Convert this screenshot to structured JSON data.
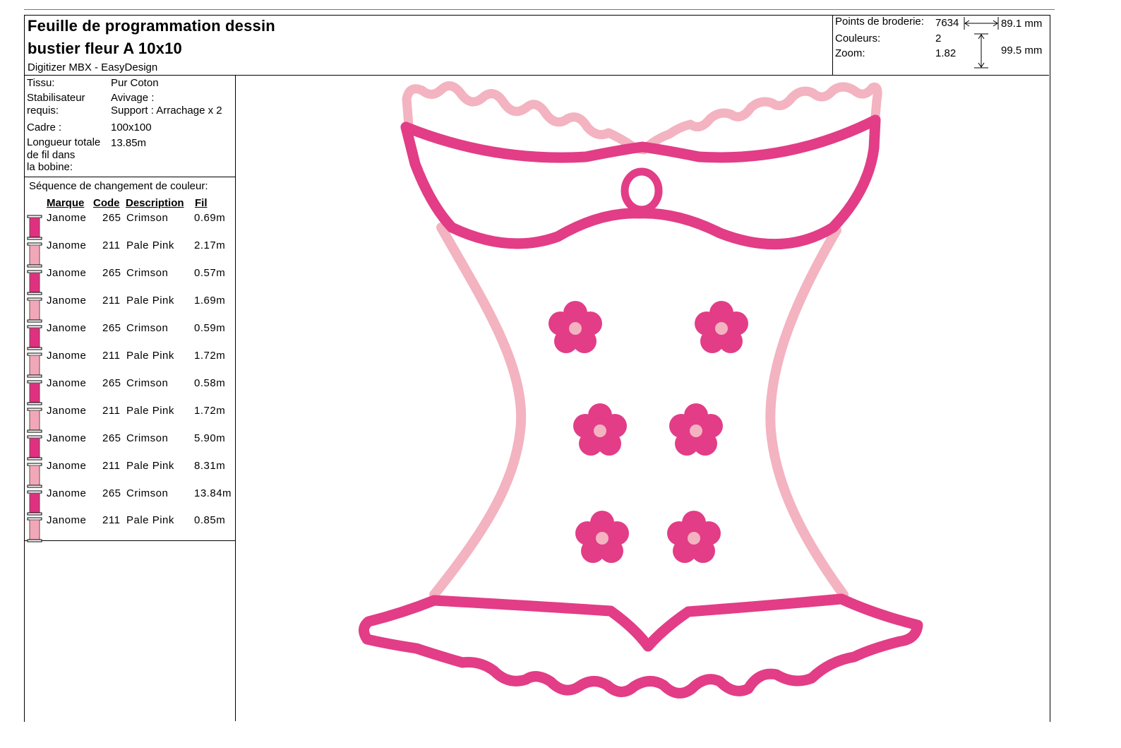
{
  "header": {
    "title_line1": "Feuille de programmation dessin",
    "title_line2": "bustier fleur A 10x10",
    "software": "Digitizer MBX - EasyDesign"
  },
  "stats": {
    "stitches_label": "Points de broderie:",
    "stitches_value": "7634",
    "colors_label": "Couleurs:",
    "colors_value": "2",
    "zoom_label": "Zoom:",
    "zoom_value": "1.82",
    "width": "89.1 mm",
    "height": "99.5 mm"
  },
  "info": {
    "fabric_label": "Tissu:",
    "fabric_value": "Pur Coton",
    "stabilizer_label_1": "Stabilisateur",
    "stabilizer_label_2": "requis:",
    "stabilizer_value_1": "Avivage :",
    "stabilizer_value_2": "Support : Arrachage x 2",
    "frame_label": "Cadre :",
    "frame_value": "100x100",
    "bobbin_label_1": "Longueur totale",
    "bobbin_label_2": "de fil dans",
    "bobbin_label_3": "la bobine:",
    "bobbin_value": "13.85m"
  },
  "sequence": {
    "title": "Séquence de changement de couleur:",
    "columns": {
      "brand": "Marque",
      "code": "Code",
      "description": "Description",
      "thread": "Fil"
    },
    "rows": [
      {
        "brand": "Janome",
        "code": "265",
        "description": "Crimson",
        "thread": "0.69m"
      },
      {
        "brand": "Janome",
        "code": "211",
        "description": "Pale Pink",
        "thread": "2.17m"
      },
      {
        "brand": "Janome",
        "code": "265",
        "description": "Crimson",
        "thread": "0.57m"
      },
      {
        "brand": "Janome",
        "code": "211",
        "description": "Pale Pink",
        "thread": "1.69m"
      },
      {
        "brand": "Janome",
        "code": "265",
        "description": "Crimson",
        "thread": "0.59m"
      },
      {
        "brand": "Janome",
        "code": "211",
        "description": "Pale Pink",
        "thread": "1.72m"
      },
      {
        "brand": "Janome",
        "code": "265",
        "description": "Crimson",
        "thread": "0.58m"
      },
      {
        "brand": "Janome",
        "code": "211",
        "description": "Pale Pink",
        "thread": "1.72m"
      },
      {
        "brand": "Janome",
        "code": "265",
        "description": "Crimson",
        "thread": "5.90m"
      },
      {
        "brand": "Janome",
        "code": "211",
        "description": "Pale Pink",
        "thread": "8.31m"
      },
      {
        "brand": "Janome",
        "code": "265",
        "description": "Crimson",
        "thread": "13.84m"
      },
      {
        "brand": "Janome",
        "code": "211",
        "description": "Pale Pink",
        "thread": "0.85m"
      }
    ]
  },
  "colors": {
    "crimson": "#e0307f",
    "pale_pink": "#f2a7b8",
    "design_crimson": "#e23d86",
    "design_pale": "#f3b3c0"
  },
  "icons": {
    "spool": "thread-spool-icon"
  }
}
